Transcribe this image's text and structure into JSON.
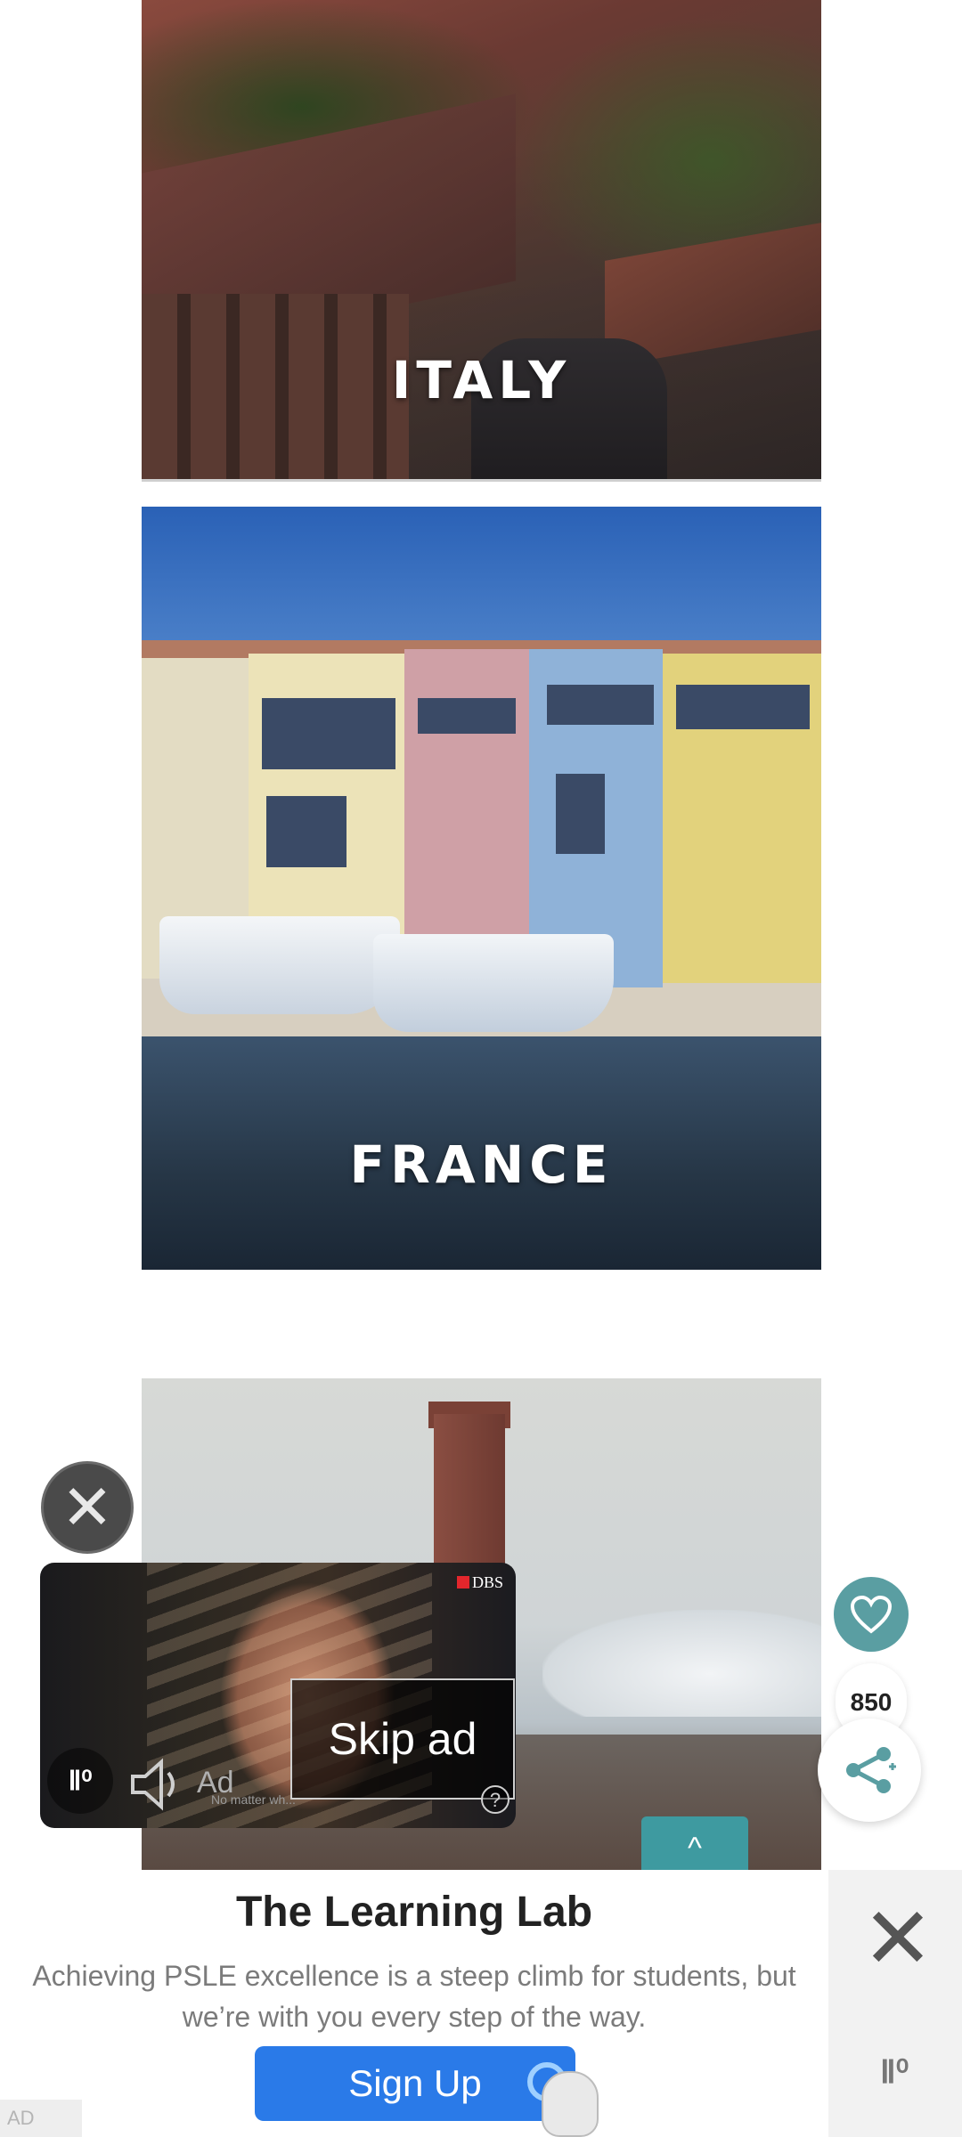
{
  "gallery": {
    "italy_label": "ITALY",
    "france_label": "FRANCE"
  },
  "video_ad": {
    "brand": "DBS",
    "ad_label": "Ad",
    "caption": "No matter wh...",
    "skip_label": "Skip ad",
    "help_glyph": "?",
    "close_glyph": "✕",
    "logo_glyph": "Ⅱ⁰"
  },
  "floating": {
    "like_count": "850",
    "scroll_top_glyph": "^"
  },
  "banner_ad": {
    "title": "The Learning Lab",
    "description": "Achieving PSLE excellence is a steep climb for students, but we’re with you every step of the way.",
    "cta": "Sign Up",
    "close_glyph": "✕",
    "logo_glyph": "Ⅱ⁰",
    "ad_tag": "AD"
  },
  "colors": {
    "accent_teal": "#5a9ea2",
    "cta_blue": "#2a7ae8",
    "dbs_red": "#e3262c"
  },
  "icons": {
    "like": "heart-icon",
    "share": "share-icon",
    "close": "close-icon",
    "sound": "speaker-icon",
    "help": "question-icon"
  }
}
